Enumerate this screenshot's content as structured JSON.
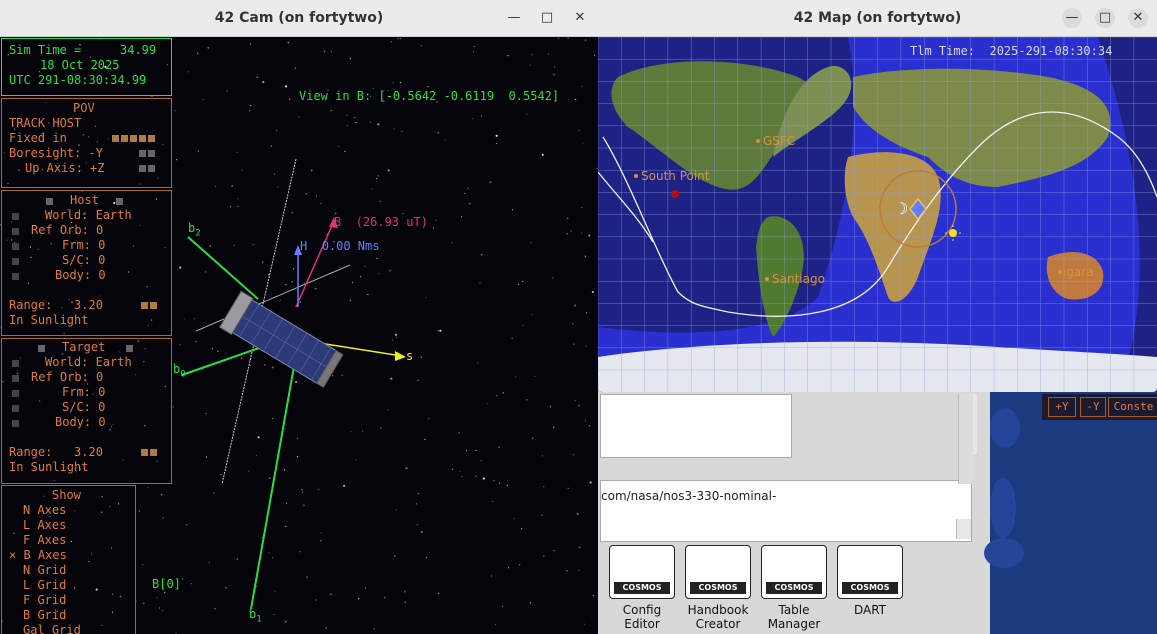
{
  "cam_window": {
    "title": "42 Cam (on fortytwo)",
    "sim_time_label": "Sim Time =",
    "sim_time_value": "34.99",
    "date": "18 Oct 2025",
    "utc": "UTC 291-08:30:34.99",
    "view_in_b": "View in B: [-0.5642 -0.6119  0.5542]",
    "pov": {
      "title": "POV",
      "track": "TRACK HOST",
      "fixed_in": "Fixed in",
      "boresight": "Boresight: -Y",
      "up_axis": "Up Axis: +Z"
    },
    "host": {
      "title": "Host",
      "world": "World: Earth",
      "ref_orb": "Ref Orb: 0",
      "frm": "Frm: 0",
      "sc": "S/C: 0",
      "body": "Body: 0",
      "range": "Range:   3.20",
      "sun": "In Sunlight"
    },
    "target": {
      "title": "Target",
      "world": "World: Earth",
      "ref_orb": "Ref Orb: 0",
      "frm": "Frm: 0",
      "sc": "S/C: 0",
      "body": "Body: 0",
      "range": "Range:   3.20",
      "sun": "In Sunlight"
    },
    "show": {
      "title": "Show",
      "items": [
        "N Axes",
        "L Axes",
        "F Axes",
        "× B Axes",
        "N Grid",
        "L Grid",
        "F Grid",
        "B Grid",
        "Gal Grid"
      ]
    },
    "vectors": {
      "b_label": "B",
      "b_value": "(26.93 uT)",
      "h_label": "H",
      "h_value": "0.00 Nms",
      "s_label": "s",
      "b2": "b",
      "b2_sub": "2",
      "b0": "b",
      "b0_sub": "0",
      "b1": "b",
      "b1_sub": "1",
      "b_index": "B[0]"
    },
    "colors": {
      "hud_orange": "#e07b3a",
      "hud_green": "#25e045",
      "b_vector": "#e0307a",
      "h_vector": "#6a7cff",
      "sun_vector": "#f0f020"
    }
  },
  "map_window": {
    "title": "42 Map (on fortytwo)",
    "tlm_time": "Tlm Time:  2025-291-08:30:34",
    "ground_stations": [
      "GSFC",
      "South Point",
      "Santiago",
      "Dongara"
    ]
  },
  "background_app": {
    "url_text": "com/nasa/nos3-330-nominal-",
    "tools": [
      {
        "line1": "Config",
        "line2": "Editor",
        "badge": "COSMOS"
      },
      {
        "line1": "Handbook",
        "line2": "Creator",
        "badge": "COSMOS"
      },
      {
        "line1": "Table",
        "line2": "Manager",
        "badge": "COSMOS"
      },
      {
        "line1": "DART",
        "line2": "",
        "badge": "COSMOS"
      }
    ],
    "ctrl_buttons": [
      "+Y",
      "-Y",
      "Conste"
    ]
  }
}
